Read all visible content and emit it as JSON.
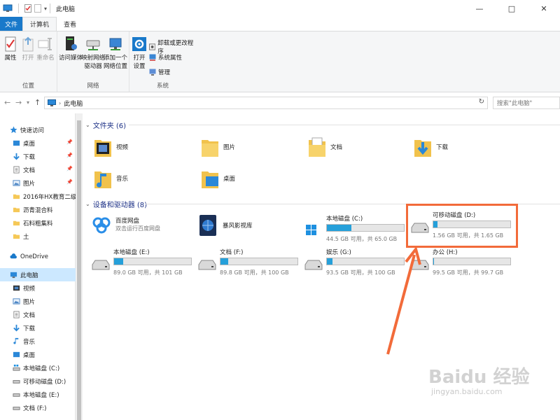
{
  "titlebar": {
    "title": "此电脑",
    "minimize": "—",
    "maximize": "□",
    "close": "✕"
  },
  "ribbon_tabs": [
    "文件",
    "计算机",
    "查看"
  ],
  "ribbon": {
    "location_group": {
      "label": "位置",
      "buttons": [
        "属性",
        "打开",
        "重命名"
      ]
    },
    "network_group": {
      "label": "网络",
      "buttons": [
        "访问媒体",
        "映射网络\n驱动器",
        "添加一个\n网络位置"
      ]
    },
    "system_group": {
      "label": "系统",
      "open_settings": "打开\n设置",
      "small_buttons": [
        "卸载或更改程序",
        "系统属性",
        "管理"
      ]
    }
  },
  "address": {
    "breadcrumb": "此电脑",
    "search_placeholder": "搜索\"此电脑\""
  },
  "nav": {
    "quick_access": "快速访问",
    "items": [
      {
        "label": "桌面",
        "pinned": true
      },
      {
        "label": "下载",
        "pinned": true
      },
      {
        "label": "文档",
        "pinned": true
      },
      {
        "label": "图片",
        "pinned": true
      },
      {
        "label": "2016年HX教育二级建造",
        "pinned": false
      },
      {
        "label": "沥青混合料",
        "pinned": false
      },
      {
        "label": "石料粗集料",
        "pinned": false
      },
      {
        "label": "土",
        "pinned": false
      }
    ],
    "onedrive": "OneDrive",
    "this_pc": "此电脑",
    "pc_items": [
      "视频",
      "图片",
      "文档",
      "下载",
      "音乐",
      "桌面",
      "本地磁盘 (C:)",
      "可移动磁盘 (D:)",
      "本地磁盘 (E:)",
      "文档 (F:)"
    ]
  },
  "folders_section": {
    "title": "文件夹 (6)",
    "folders": [
      "视频",
      "图片",
      "文档",
      "下载",
      "音乐",
      "桌面"
    ]
  },
  "drives_section": {
    "title": "设备和驱动器 (8)",
    "apps": [
      {
        "name": "百度网盘",
        "sub": "双击运行百度网盘"
      },
      {
        "name": "暴风影视库",
        "sub": ""
      }
    ],
    "drives": [
      {
        "name": "本地磁盘 (C:)",
        "size": "44.5 GB 可用，共 65.0 GB",
        "used_fraction": 0.32
      },
      {
        "name": "可移动磁盘 (D:)",
        "size": "1.56 GB 可用，共 1.65 GB",
        "used_fraction": 0.05
      },
      {
        "name": "本地磁盘 (E:)",
        "size": "89.0 GB 可用，共 101 GB",
        "used_fraction": 0.12
      },
      {
        "name": "文档 (F:)",
        "size": "89.8 GB 可用，共 100 GB",
        "used_fraction": 0.1
      },
      {
        "name": "娱乐 (G:)",
        "size": "93.5 GB 可用，共 100 GB",
        "used_fraction": 0.07
      },
      {
        "name": "办公 (H:)",
        "size": "99.5 GB 可用，共 99.7 GB",
        "used_fraction": 0.01
      }
    ]
  },
  "watermark": {
    "logo": "Baidu 经验",
    "url": "jingyan.baidu.com"
  },
  "colors": {
    "accent": "#1979ca",
    "bar_fill": "#26a0da",
    "highlight": "#f26b3a",
    "section_text": "#1e3287"
  }
}
